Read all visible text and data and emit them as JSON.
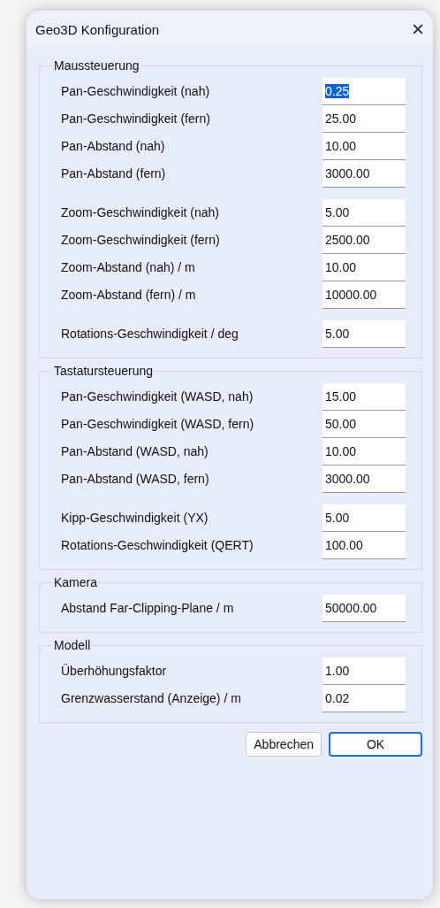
{
  "window": {
    "title": "Geo3D Konfiguration",
    "close": "×"
  },
  "groups": [
    {
      "title": "Maussteuerung",
      "clusters": [
        [
          {
            "label": "Pan-Geschwindigkeit (nah)",
            "value": "0.25",
            "selected": true
          },
          {
            "label": "Pan-Geschwindigkeit (fern)",
            "value": "25.00",
            "selected": false
          },
          {
            "label": "Pan-Abstand (nah)",
            "value": "10.00",
            "selected": false
          },
          {
            "label": "Pan-Abstand (fern)",
            "value": "3000.00",
            "selected": false
          }
        ],
        [
          {
            "label": "Zoom-Geschwindigkeit (nah)",
            "value": "5.00",
            "selected": false
          },
          {
            "label": "Zoom-Geschwindigkeit (fern)",
            "value": "2500.00",
            "selected": false
          },
          {
            "label": "Zoom-Abstand (nah) / m",
            "value": "10.00",
            "selected": false
          },
          {
            "label": "Zoom-Abstand (fern) / m",
            "value": "10000.00",
            "selected": false
          }
        ],
        [
          {
            "label": "Rotations-Geschwindigkeit / deg",
            "value": "5.00",
            "selected": false
          }
        ]
      ]
    },
    {
      "title": "Tastatursteuerung",
      "clusters": [
        [
          {
            "label": "Pan-Geschwindigkeit (WASD, nah)",
            "value": "15.00",
            "selected": false
          },
          {
            "label": "Pan-Geschwindigkeit (WASD, fern)",
            "value": "50.00",
            "selected": false
          },
          {
            "label": "Pan-Abstand (WASD, nah)",
            "value": "10.00",
            "selected": false
          },
          {
            "label": "Pan-Abstand (WASD, fern)",
            "value": "3000.00",
            "selected": false
          }
        ],
        [
          {
            "label": "Kipp-Geschwindigkeit (YX)",
            "value": "5.00",
            "selected": false
          },
          {
            "label": "Rotations-Geschwindigkeit (QERT)",
            "value": "100.00",
            "selected": false
          }
        ]
      ]
    },
    {
      "title": "Kamera",
      "clusters": [
        [
          {
            "label": "Abstand Far-Clipping-Plane / m",
            "value": "50000.00",
            "selected": false
          }
        ]
      ]
    },
    {
      "title": "Modell",
      "clusters": [
        [
          {
            "label": "Überhöhungsfaktor",
            "value": "1.00",
            "selected": false
          },
          {
            "label": "Grenzwasserstand (Anzeige) / m",
            "value": "0.02",
            "selected": false
          }
        ]
      ]
    }
  ],
  "buttons": [
    {
      "label": "Abbrechen",
      "default": false
    },
    {
      "label": "OK",
      "default": true
    }
  ]
}
